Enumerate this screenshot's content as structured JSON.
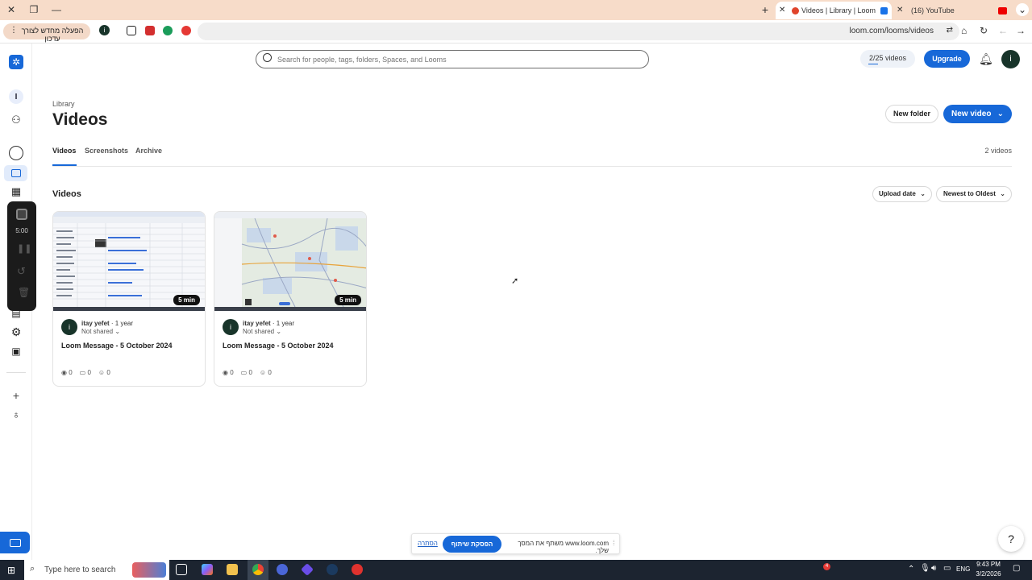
{
  "browser": {
    "tabs": [
      {
        "title": "Videos | Library | Loom",
        "active": true
      },
      {
        "title": "(16) YouTube",
        "active": false
      }
    ],
    "url": "loom.com/looms/videos",
    "update_text": "הפעלה מחדש לצורך עדכון",
    "profile_initial": "i"
  },
  "header": {
    "search_placeholder": "Search for people, tags, folders, Spaces, and Looms",
    "video_quota": "2/25 videos",
    "upgrade_label": "Upgrade",
    "avatar_initial": "i"
  },
  "sidebar": {
    "workspace_initial": "I",
    "recorder_time": "5:00"
  },
  "page": {
    "breadcrumb": "Library",
    "title": "Videos",
    "new_folder_label": "New folder",
    "new_video_label": "New video",
    "tabs": [
      "Videos",
      "Screenshots",
      "Archive"
    ],
    "video_count": "2 videos",
    "section_title": "Videos",
    "sort_field": "Upload date",
    "sort_order": "Newest to Oldest"
  },
  "videos": [
    {
      "duration": "5 min",
      "author": "itay yefet",
      "age": "1 year",
      "sharing": "Not shared",
      "title": "Loom Message - 5 October 2024",
      "views": "0",
      "comments": "0",
      "reactions": "0",
      "avatar_initial": "i"
    },
    {
      "duration": "5 min",
      "author": "itay yefet",
      "age": "1 year",
      "sharing": "Not shared",
      "title": "Loom Message - 5 October 2024",
      "views": "0",
      "comments": "0",
      "reactions": "0",
      "avatar_initial": "i"
    }
  ],
  "share_bar": {
    "hide_label": "הסתרה",
    "stop_label": "הפסקת שיתוף",
    "message": "www.loom.com משתף את המסך שלך."
  },
  "help_label": "?",
  "taskbar": {
    "search_placeholder": "Type here to search",
    "language": "ENG",
    "time": "9:43 PM",
    "date": "3/2/2026",
    "badge": "4"
  },
  "colors": {
    "accent": "#1768d8",
    "tabbar": "#f7dcc9",
    "avatar": "#18342a"
  }
}
